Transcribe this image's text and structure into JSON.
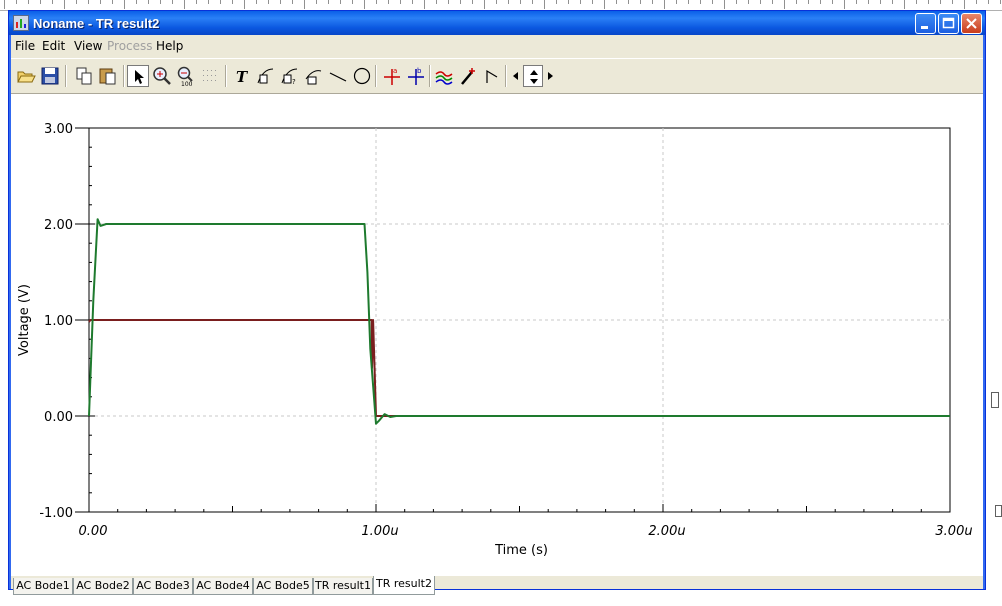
{
  "window": {
    "title": "Noname - TR result2"
  },
  "menu": [
    {
      "label": "File",
      "enabled": true
    },
    {
      "label": "Edit",
      "enabled": true
    },
    {
      "label": "View",
      "enabled": true
    },
    {
      "label": "Process",
      "enabled": false
    },
    {
      "label": "Help",
      "enabled": true
    }
  ],
  "toolbar": [
    "open-icon",
    "save-icon",
    "copy-icon",
    "paste-icon",
    "pointer-icon",
    "zoom-in-icon",
    "zoom-100-icon",
    "grid-icon",
    "text-icon",
    "curve-label-icon",
    "curve-label-2-icon",
    "curve-label-3-icon",
    "line-icon",
    "circle-icon",
    "cursor-a-icon",
    "cursor-b-icon",
    "curves-icon",
    "pen-icon",
    "marker-icon",
    "scroll-left-icon",
    "scroll-updown-icon",
    "scroll-right-icon"
  ],
  "tabs": [
    {
      "label": "AC Bode1",
      "active": false
    },
    {
      "label": "AC Bode2",
      "active": false
    },
    {
      "label": "AC Bode3",
      "active": false
    },
    {
      "label": "AC Bode4",
      "active": false
    },
    {
      "label": "AC Bode5",
      "active": false
    },
    {
      "label": "TR result1",
      "active": false
    },
    {
      "label": "TR result2",
      "active": true
    }
  ],
  "colors": {
    "trace_green": "#1e7a2e",
    "trace_red": "#7a1e1e",
    "grid": "#c8c8c8"
  },
  "chart_data": {
    "type": "line",
    "xlabel": "Time (s)",
    "ylabel": "Voltage (V)",
    "xlim": [
      0,
      3e-06
    ],
    "ylim": [
      -1,
      3
    ],
    "x_ticks": [
      0,
      1e-06,
      2e-06,
      3e-06
    ],
    "x_tick_labels": [
      "0.00",
      "1.00u",
      "2.00u",
      "3.00u"
    ],
    "y_ticks": [
      3,
      2,
      1,
      0,
      -1
    ],
    "y_tick_labels": [
      "3.00",
      "2.00",
      "1.00",
      "0.00",
      "-1.00"
    ],
    "grid": true,
    "series": [
      {
        "color": "#7a1e1e",
        "x": [
          0,
          5e-09,
          9.85e-07,
          9.86e-07,
          9.9e-07,
          1e-06,
          3e-06
        ],
        "y": [
          0.98,
          1.0,
          1.0,
          0.5,
          1.0,
          0.0,
          0.0
        ]
      },
      {
        "color": "#1e7a2e",
        "x": [
          0,
          1.5e-08,
          3e-08,
          4e-08,
          6e-08,
          8e-08,
          9.6e-07,
          9.7e-07,
          9.8e-07,
          1e-06,
          1.01e-06,
          1.03e-06,
          1.05e-06,
          1.07e-06,
          1.1e-06,
          3e-06
        ],
        "y": [
          0.0,
          1.2,
          2.05,
          1.98,
          2.0,
          2.0,
          2.0,
          1.5,
          0.7,
          -0.08,
          -0.05,
          0.02,
          -0.01,
          0.0,
          0.0,
          0.0
        ]
      }
    ]
  }
}
